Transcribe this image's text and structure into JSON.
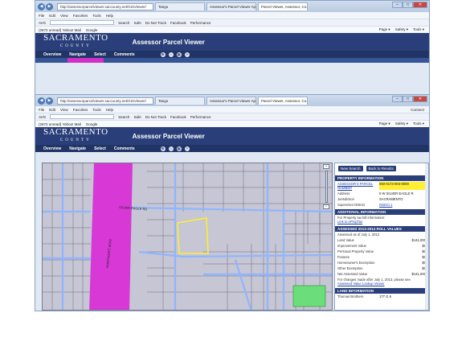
{
  "browser": {
    "address": "http://assessorparcelviewer.saccounty.net/GISViewer/",
    "tabs": [
      "Tango",
      "Assessor's Parcel Viewer Applic...",
      "Parcel Viewer, Assessor, Co..."
    ],
    "menu": [
      "File",
      "Edit",
      "View",
      "Favorites",
      "Tools",
      "Help"
    ],
    "toolbar": [
      "AVG",
      "Search",
      "Safe",
      "Do Not Track",
      "Facebook",
      "Performance"
    ],
    "favorites": [
      "(2672 unread) Yahoo! Mail",
      "Google"
    ],
    "favorites_right": [
      "Page ▾",
      "Safety ▾",
      "Tools ▾"
    ],
    "connect": "Connect"
  },
  "app": {
    "logo_line1": "SACRAMENTO",
    "logo_line2": "COUNTY",
    "title": "Assessor Parcel Viewer",
    "nav": [
      "Overview",
      "Navigate",
      "Select",
      "Comments"
    ]
  },
  "panel": {
    "buttons": [
      "New Search",
      "Back to Results"
    ],
    "property_header": "PROPERTY INFORMATION",
    "parcel_label": "ASSESSOR'S PARCEL NUMBER",
    "parcel_value": "050-0173-004-0000",
    "address_label": "Address",
    "address_value": "0 W SILVER EAGLE R",
    "jurisdiction_label": "Jurisdiction",
    "jurisdiction_value": "SACRAMENTO",
    "supervisor_label": "Supervisor District",
    "supervisor_value": "District 1",
    "additional_header": "ADDITIONAL INFORMATION",
    "additional_text": "For Property tax bill information:",
    "additional_link": "Link to ePropTax",
    "roll_header": "ASSESSED 2013-2014 ROLL VALUES",
    "roll_date": "Assessed as of July 1, 2013",
    "roll_rows": [
      [
        "Land Value",
        "$141,000"
      ],
      [
        "Improvement Value",
        "$0"
      ],
      [
        "Personal Property Value",
        "$0"
      ],
      [
        "Fixtures",
        "$0"
      ],
      [
        "Homeowner's Exemption",
        "$0"
      ],
      [
        "Other Exemption",
        "$0"
      ],
      [
        "Net Assessed Value",
        "$141,000"
      ]
    ],
    "roll_note": "For changes made after July 1, 2013, please see",
    "roll_note_link": "Assessed Value Lookup Viewer",
    "land_header": "LAND INFORMATION",
    "land_row": [
      "Thomas Brothers",
      "177 G 6"
    ]
  },
  "map": {
    "labels": [
      "SILVER EAGLE RD",
      "NORTHGATE BLVD"
    ]
  }
}
